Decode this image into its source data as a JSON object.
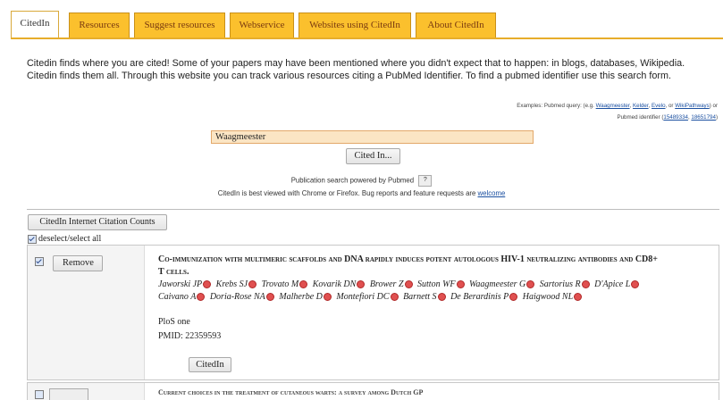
{
  "tabs": [
    {
      "label": "CitedIn",
      "active": true
    },
    {
      "label": "Resources",
      "active": false
    },
    {
      "label": "Suggest resources",
      "active": false
    },
    {
      "label": "Webservice",
      "active": false
    },
    {
      "label": "Websites using CitedIn",
      "active": false
    },
    {
      "label": "About CitedIn",
      "active": false
    }
  ],
  "intro": {
    "text": "Citedin finds where you are cited! Some of your papers may have been mentioned where you didn't expect that to happen: in blogs, databases, Wikipedia. Citedin finds them all. Through this website you can track various resources citing a PubMed Identifier. To find a pubmed identifier use this search form."
  },
  "examples": {
    "prefix": "Examples: Pubmed query: (e.g.",
    "links1": [
      "Waagmeester",
      "Kelder",
      "Evelo"
    ],
    "sep1": ", ",
    "or1": ", or ",
    "link4": "WikiPathways",
    "suffix1": ") or",
    "pmid_prefix": "Pubmed identifier (",
    "pmid_links": [
      "15489334",
      "18651794"
    ],
    "pmid_suffix": ")"
  },
  "search": {
    "value": "Waagmeester",
    "button_label": "Cited In..."
  },
  "powered_by": "Publication search powered by Pubmed",
  "help_label": "?",
  "best_viewed_text": "CitedIn is best viewed with Chrome or Firefox. Bug reports and feature requests are",
  "welcome_link": "welcome",
  "counts_button": "CitedIn Internet Citation Counts",
  "deselect_label": "deselect/select all",
  "result": {
    "remove_label": "Remove",
    "title": "Co-immunization with multimeric scaffolds and DNA rapidly induces potent autologous HIV-1 neutralizing antibodies and CD8+ T cells.",
    "authors": [
      "Jaworski JP",
      "Krebs SJ",
      "Trovato M",
      "Kovarik DN",
      "Brower Z",
      "Sutton WF",
      "Waagmeester G",
      "Sartorius R",
      "D'Apice L",
      "Caivano A",
      "Doria-Rose NA",
      "Malherbe D",
      "Montefiori DC",
      "Barnett S",
      "De Berardinis P",
      "Haigwood NL"
    ],
    "journal": "PloS one",
    "pmid": "PMID: 22359593",
    "citedin_label": "CitedIn"
  },
  "next_result": {
    "title": "Current choices in the treatment of cutaneous warts: a survey among Dutch GP"
  },
  "colors": {
    "tab_bg": "#fbc02d",
    "tab_text": "#7a3a10",
    "search_bg": "#fbe5c4",
    "author_dot": "#e05050",
    "link": "#1a4fa0"
  }
}
